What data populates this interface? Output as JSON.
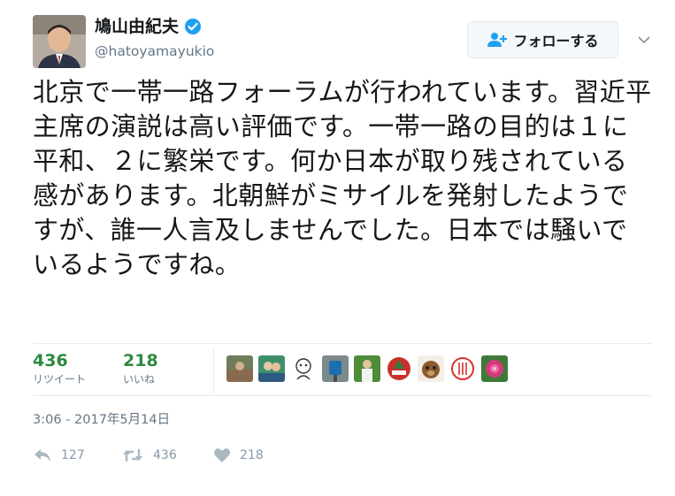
{
  "user": {
    "display_name": "鳩山由紀夫",
    "username": "@hatoyamayukio",
    "verified_icon": "verified-badge-icon"
  },
  "follow_button": {
    "label": "フォローする",
    "icon": "person-add-icon"
  },
  "tweet": {
    "text": "北京で一帯一路フォーラムが行われています。習近平主席の演説は高い評価です。一帯一路の目的は１に平和、２に繁栄です。何か日本が取り残されている感があります。北朝鮮がミサイルを発射したようですが、誰一人言及しませんでした。日本では騒いでいるようですね。",
    "timestamp": "3:06 - 2017年5月14日"
  },
  "stats": {
    "retweets": {
      "count": "436",
      "label": "リツイート"
    },
    "likes": {
      "count": "218",
      "label": "いいね"
    }
  },
  "likers": [
    "avatar-1",
    "avatar-2",
    "avatar-3",
    "avatar-4",
    "avatar-5",
    "avatar-6",
    "avatar-7",
    "avatar-8",
    "avatar-9"
  ],
  "actions": {
    "reply": {
      "count": "127",
      "icon": "reply-icon"
    },
    "retweet": {
      "count": "436",
      "icon": "retweet-icon"
    },
    "like": {
      "count": "218",
      "icon": "heart-icon"
    }
  },
  "colors": {
    "stat_count": "#2b8a3e",
    "verified": "#1da1f2",
    "muted": "#657786",
    "action": "#8899a6"
  }
}
